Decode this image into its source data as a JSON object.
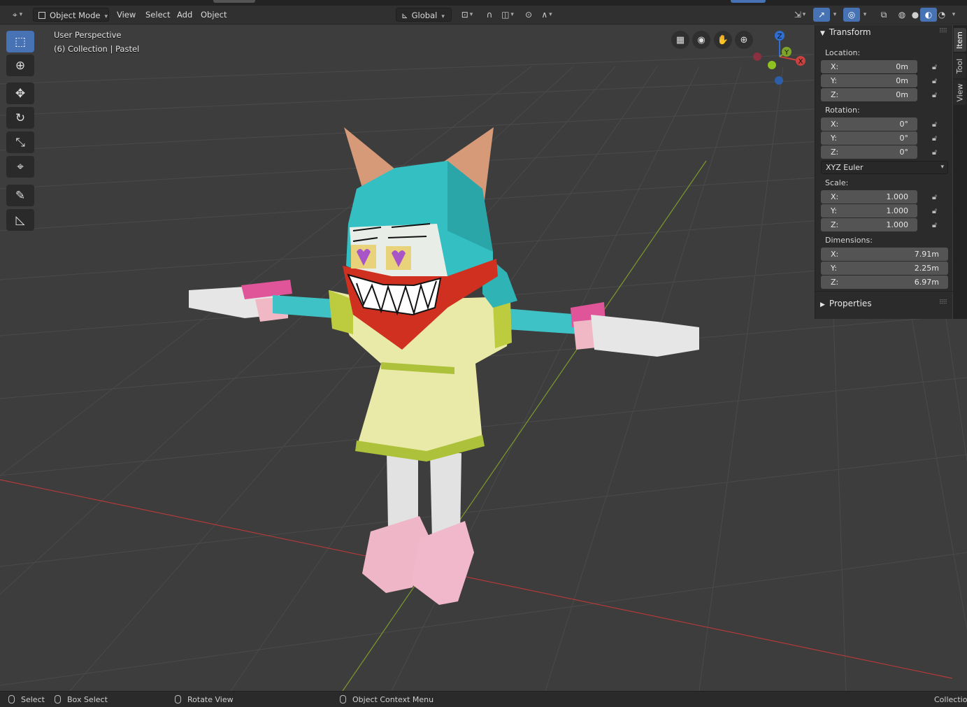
{
  "header": {
    "editor_type_icon": "view3d-icon",
    "mode_label": "Object Mode",
    "menus": [
      "View",
      "Select",
      "Add",
      "Object"
    ],
    "orientation_label": "Global",
    "pivot_icon": "pivot-point-icon",
    "snap_icon": "snap-magnet-icon",
    "proportional_icon": "proportional-edit-icon",
    "shading_modes": [
      "wireframe",
      "solid",
      "material-preview",
      "rendered"
    ]
  },
  "viewport": {
    "perspective_label": "User Perspective",
    "collection_label": "(6) Collection | Pastel",
    "gizmo": {
      "x": "X",
      "y": "Y",
      "z": "Z"
    },
    "axis_colors": {
      "x": "#c8413f",
      "y": "#7fa42a",
      "z": "#2f6fd4"
    }
  },
  "toolbar": {
    "tools": [
      {
        "name": "select-box-icon",
        "glyph": "⬚"
      },
      {
        "name": "cursor-icon",
        "glyph": "⊕"
      },
      {
        "name": "move-icon",
        "glyph": "✥"
      },
      {
        "name": "rotate-icon",
        "glyph": "↻"
      },
      {
        "name": "scale-icon",
        "glyph": "⤡"
      },
      {
        "name": "transform-icon",
        "glyph": "⌖"
      },
      {
        "name": "annotate-icon",
        "glyph": "✎"
      },
      {
        "name": "measure-icon",
        "glyph": "📐"
      }
    ]
  },
  "panel": {
    "transform_title": "Transform",
    "location_label": "Location:",
    "location": [
      {
        "axis": "X:",
        "value": "0m"
      },
      {
        "axis": "Y:",
        "value": "0m"
      },
      {
        "axis": "Z:",
        "value": "0m"
      }
    ],
    "rotation_label": "Rotation:",
    "rotation": [
      {
        "axis": "X:",
        "value": "0°"
      },
      {
        "axis": "Y:",
        "value": "0°"
      },
      {
        "axis": "Z:",
        "value": "0°"
      }
    ],
    "rotation_mode": "XYZ Euler",
    "scale_label": "Scale:",
    "scale": [
      {
        "axis": "X:",
        "value": "1.000"
      },
      {
        "axis": "Y:",
        "value": "1.000"
      },
      {
        "axis": "Z:",
        "value": "1.000"
      }
    ],
    "dimensions_label": "Dimensions:",
    "dimensions": [
      {
        "axis": "X:",
        "value": "7.91m"
      },
      {
        "axis": "Y:",
        "value": "2.25m"
      },
      {
        "axis": "Z:",
        "value": "6.97m"
      }
    ],
    "properties_title": "Properties"
  },
  "tabs": [
    "Item",
    "Tool",
    "View"
  ],
  "status": {
    "select": "Select",
    "box_select": "Box Select",
    "rotate_view": "Rotate View",
    "context_menu": "Object Context Menu",
    "right": "Collection"
  }
}
